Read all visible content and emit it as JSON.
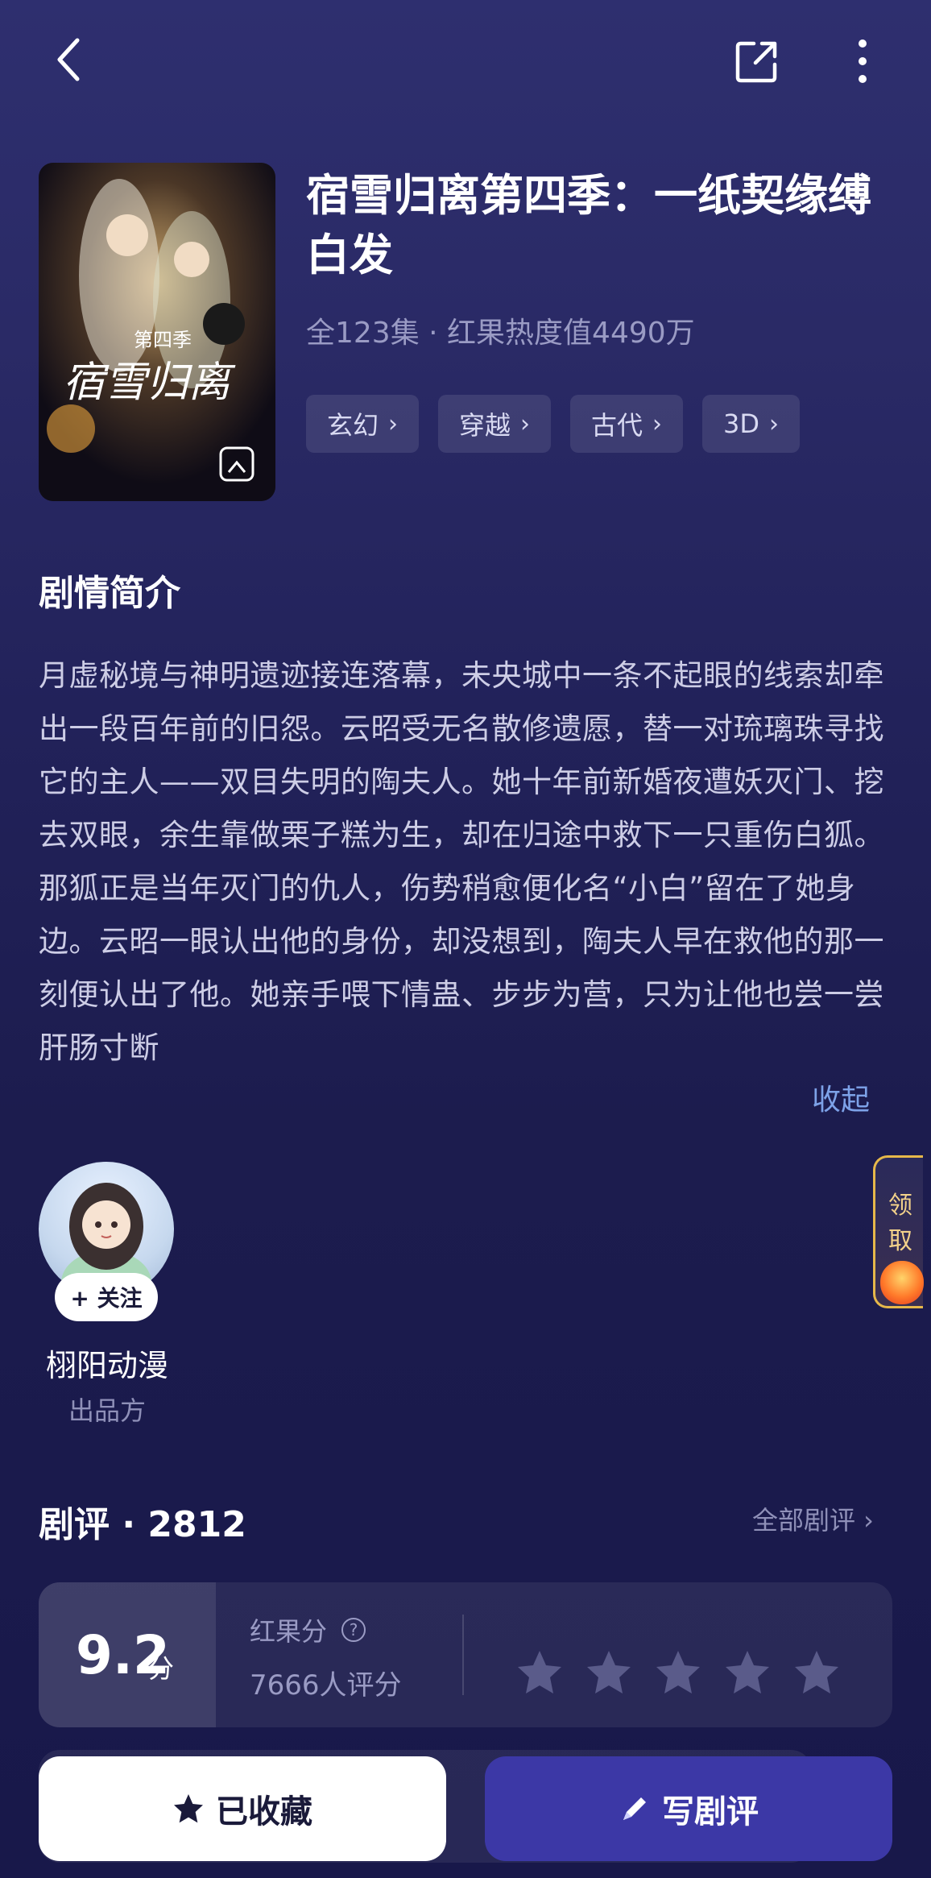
{
  "header": {
    "back_icon": "chevron-left-icon",
    "share_icon": "share-icon",
    "more_icon": "more-vertical-icon"
  },
  "drama": {
    "title": "宿雪归离第四季：一纸契缘缚白发",
    "meta": "全123集 · 红果热度值4490万",
    "tags": [
      {
        "label": "玄幻"
      },
      {
        "label": "穿越"
      },
      {
        "label": "古代"
      },
      {
        "label": "3D"
      }
    ],
    "cover_title": "宿雪归离",
    "cover_season": "第四季"
  },
  "synopsis": {
    "heading": "剧情简介",
    "text": "月虚秘境与神明遗迹接连落幕，未央城中一条不起眼的线索却牵出一段百年前的旧怨。云昭受无名散修遗愿，替一对琉璃珠寻找它的主人——双目失明的陶夫人。她十年前新婚夜遭妖灭门、挖去双眼，余生靠做栗子糕为生，却在归途中救下一只重伤白狐。那狐正是当年灭门的仇人，伤势稍愈便化名“小白”留在了她身边。云昭一眼认出他的身份，却没想到，陶夫人早在救他的那一刻便认出了他。她亲手喂下情蛊、步步为营，只为让他也尝一尝肝肠寸断",
    "collapse_label": "收起"
  },
  "gift": {
    "label": "领取"
  },
  "producer": {
    "follow_label": "+ 关注",
    "name": "栩阳动漫",
    "role": "出品方"
  },
  "reviews": {
    "title": "剧评 · 2812",
    "all_label": "全部剧评 ›",
    "score": "9.2",
    "score_unit": "分",
    "rating_label": "红果分",
    "rating_count": "7666人评分",
    "stars": 5
  },
  "actions": {
    "collected_label": "已收藏",
    "write_label": "写剧评"
  },
  "colors": {
    "background": "#22225a",
    "accent": "#3c38a6",
    "link": "#7da2e8"
  }
}
